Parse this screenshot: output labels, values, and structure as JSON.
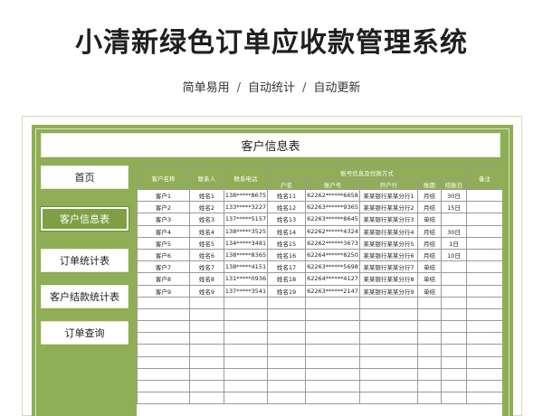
{
  "header": {
    "title": "小清新绿色订单应收款管理系统",
    "features": [
      "简单易用",
      "自动统计",
      "自动更新"
    ],
    "separator": "/"
  },
  "sheet": {
    "title": "客户信息表"
  },
  "nav": {
    "items": [
      {
        "label": "首页",
        "active": false
      },
      {
        "label": "客户信息表",
        "active": true
      },
      {
        "label": "订单统计表",
        "active": false
      },
      {
        "label": "客户结款统计表",
        "active": false
      },
      {
        "label": "订单查询",
        "active": false
      }
    ]
  },
  "table": {
    "headers": {
      "customer_name": "客户名称",
      "contact": "联系人",
      "phone": "联系电话",
      "account_group": "账号信息及付款方式",
      "account_name": "户名",
      "account_no": "账户号",
      "bank": "开户行",
      "terms": "账期",
      "settle_day": "结账日",
      "notes": "备注"
    },
    "rows": [
      [
        "客户1",
        "姓名1",
        "138*****8675",
        "姓名11",
        "62262******6658",
        "某某银行某某分行1",
        "月结",
        "30日",
        ""
      ],
      [
        "客户2",
        "姓名2",
        "133*****3227",
        "姓名12",
        "62263******9365",
        "某某银行某某分行2",
        "月结",
        "15日",
        ""
      ],
      [
        "客户3",
        "姓名3",
        "137*****5157",
        "姓名13",
        "62263******8645",
        "某某银行某某分行3",
        "单结",
        "",
        ""
      ],
      [
        "客户4",
        "姓名4",
        "138*****3525",
        "姓名14",
        "62262******4324",
        "某某银行某某分行4",
        "月结",
        "30日",
        ""
      ],
      [
        "客户5",
        "姓名5",
        "134*****3481",
        "姓名15",
        "62262******3673",
        "某某银行某某分行5",
        "月结",
        "1日",
        ""
      ],
      [
        "客户6",
        "姓名6",
        "138*****8365",
        "姓名16",
        "62264******8250",
        "某某银行某某分行6",
        "月结",
        "10日",
        ""
      ],
      [
        "客户7",
        "姓名7",
        "138*****4151",
        "姓名17",
        "62263******5698",
        "某某银行某某分行7",
        "单结",
        "",
        ""
      ],
      [
        "客户8",
        "姓名8",
        "131*****0936",
        "姓名18",
        "62264******4127",
        "某某银行某某分行8",
        "单结",
        "",
        ""
      ],
      [
        "客户9",
        "姓名9",
        "137*****3541",
        "姓名19",
        "62263******2147",
        "某某银行某某分行9",
        "单结",
        "",
        ""
      ]
    ],
    "empty_row_count": 9
  }
}
